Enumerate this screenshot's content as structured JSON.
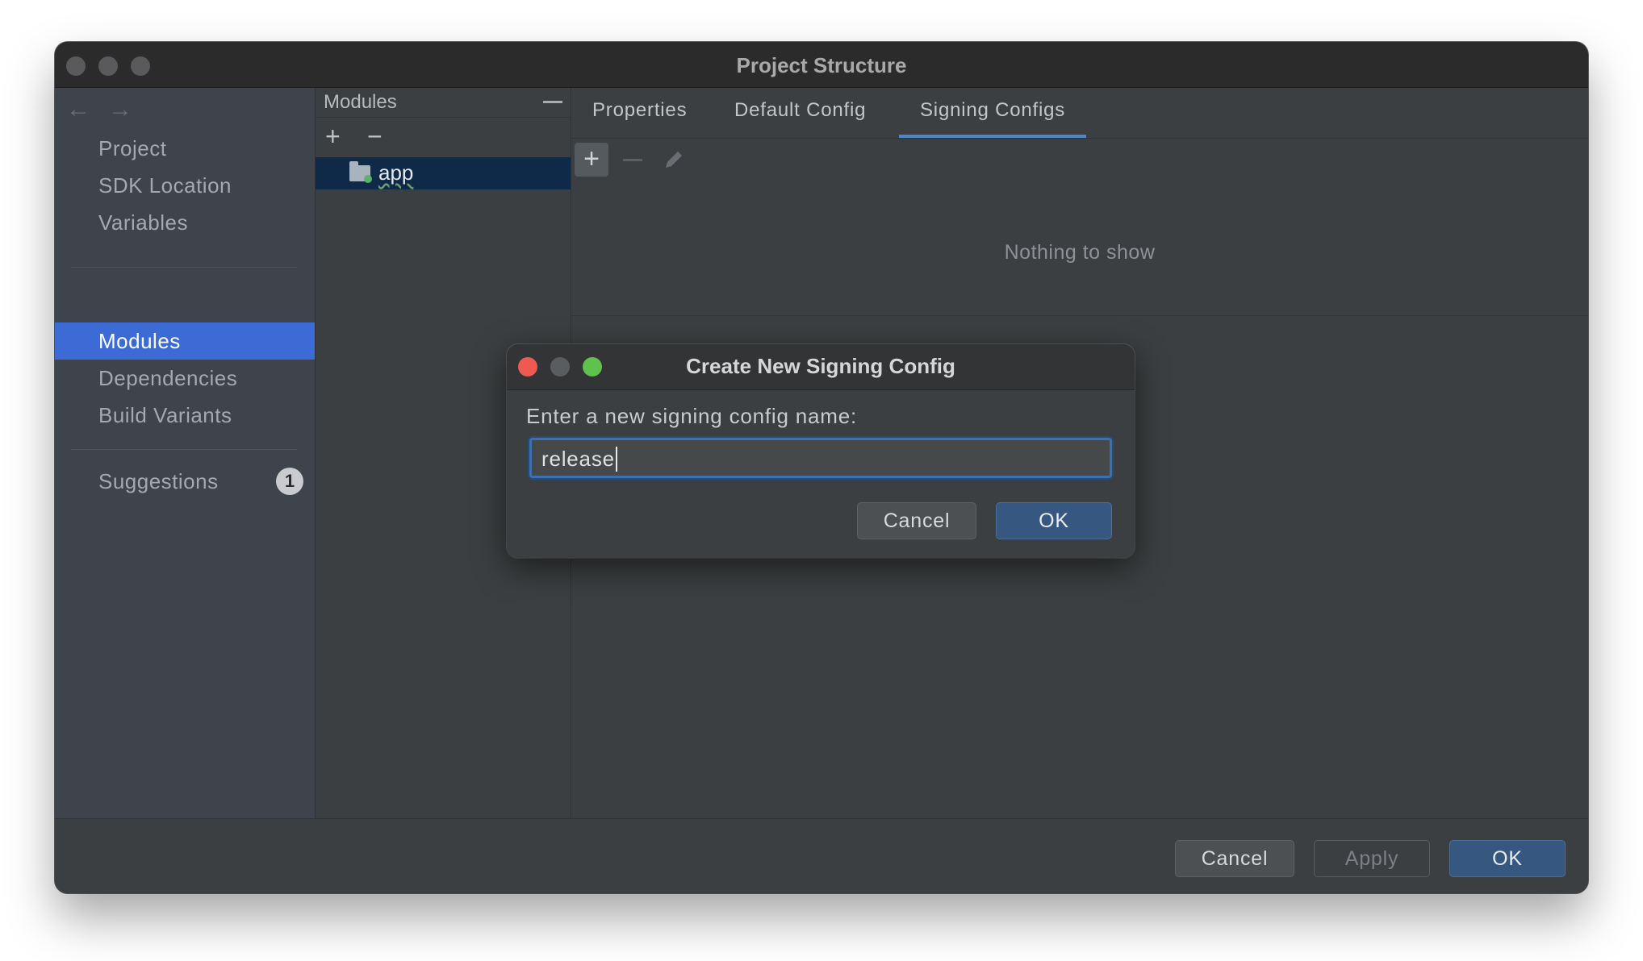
{
  "window": {
    "title": "Project Structure"
  },
  "sidebar": {
    "back_arrow": "←",
    "forward_arrow": "→",
    "items": [
      {
        "label": "Project"
      },
      {
        "label": "SDK Location"
      },
      {
        "label": "Variables"
      },
      {
        "label": "Modules",
        "active": true
      },
      {
        "label": "Dependencies"
      },
      {
        "label": "Build Variants"
      },
      {
        "label": "Suggestions",
        "badge": "1"
      }
    ]
  },
  "modules_panel": {
    "title": "Modules",
    "add": "+",
    "remove": "−",
    "items": [
      {
        "label": "app",
        "icon": "module-folder-icon",
        "selected": true
      }
    ]
  },
  "content": {
    "tabs": [
      {
        "label": "Properties"
      },
      {
        "label": "Default Config"
      },
      {
        "label": "Signing Configs",
        "selected": true
      }
    ],
    "toolbar": {
      "add": "+",
      "edit_icon": "pencil-icon"
    },
    "empty_text": "Nothing to show"
  },
  "footer": {
    "cancel": "Cancel",
    "apply": "Apply",
    "ok": "OK"
  },
  "dialog": {
    "title": "Create New Signing Config",
    "prompt": "Enter a new signing config name:",
    "input_value": "release",
    "cancel": "Cancel",
    "ok": "OK"
  },
  "colors": {
    "accent": "#3d6bd6",
    "primary_button": "#365880",
    "tab_underline": "#4a88c7",
    "close": "#ee5a52",
    "zoom": "#5fc24c"
  }
}
